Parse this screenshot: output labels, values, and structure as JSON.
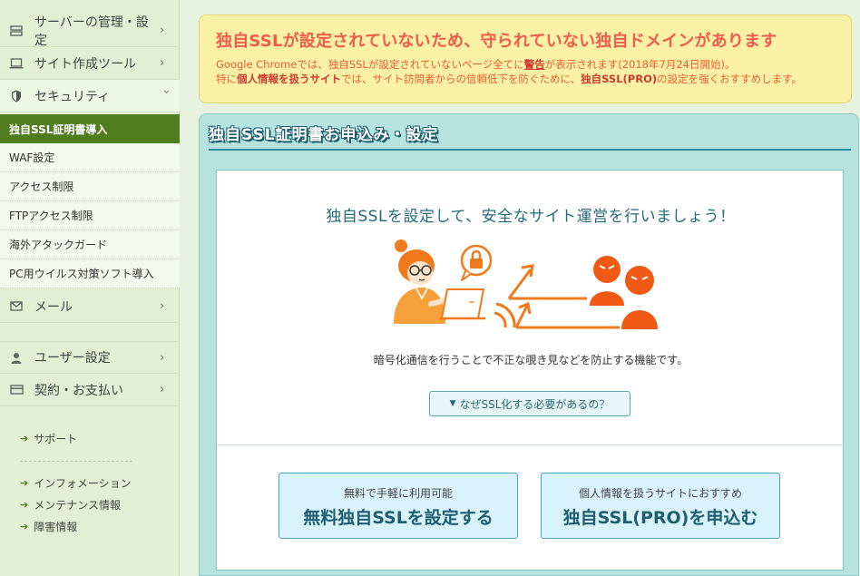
{
  "sidebar": {
    "nav": [
      {
        "label": "サーバーの管理・設定",
        "icon": "server-icon"
      },
      {
        "label": "サイト作成ツール",
        "icon": "laptop-icon"
      },
      {
        "label": "セキュリティ",
        "icon": "shield-icon"
      }
    ],
    "security_sub": [
      "独自SSL証明書導入",
      "WAF設定",
      "アクセス制限",
      "FTPアクセス制限",
      "海外アタックガード",
      "PC用ウイルス対策ソフト導入"
    ],
    "nav2": [
      {
        "label": "メール",
        "icon": "mail-icon"
      },
      {
        "label": "ユーザー設定",
        "icon": "user-icon"
      },
      {
        "label": "契約・お支払い",
        "icon": "credit-card-icon"
      }
    ],
    "links": [
      "サポート",
      "インフォメーション",
      "メンテナンス情報",
      "障害情報"
    ]
  },
  "alert": {
    "title": "独自SSLが設定されていないため、守られていない独自ドメインがあります",
    "line1_a": "Google Chromeでは、独自SSLが設定されていないページ全てに",
    "line1_b": "警告",
    "line1_c": "が表示されます(2018年7月24日開始)。",
    "line2_a": "特に",
    "line2_b": "個人情報を扱うサイト",
    "line2_c": "では、サイト訪問者からの信頼低下を防ぐために、",
    "line2_d": "独自SSL(PRO)",
    "line2_e": "の設定を強くおすすめします。"
  },
  "panel": {
    "title": "独自SSL証明書お申込み・設定",
    "heading": "独自SSLを設定して、安全なサイト運営を行いましょう！",
    "description": "暗号化通信を行うことで不正な覗き見などを防止する機能です。",
    "why_button": "なぜSSL化する必要があるの？",
    "cta_free_small": "無料で手軽に利用可能",
    "cta_free_big": "無料独自SSLを設定する",
    "cta_pro_small": "個人情報を扱うサイトにおすすめ",
    "cta_pro_big": "独自SSL(PRO)を申込む"
  },
  "colors": {
    "accent_green": "#4f7d1f",
    "alert_red": "#ee5c4b",
    "teal": "#2a8d99",
    "illustration_orange": "#f07a1c"
  }
}
